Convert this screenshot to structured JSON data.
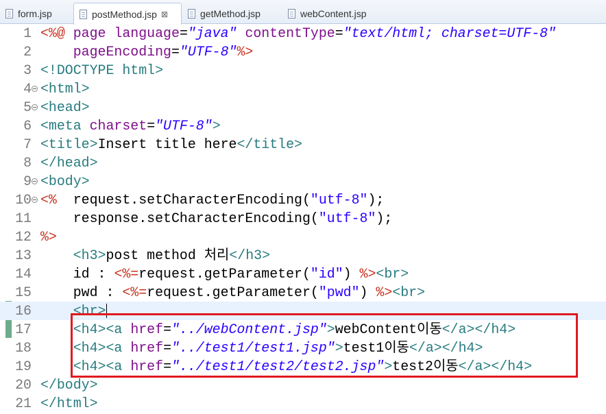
{
  "tabs": [
    {
      "label": "form.jsp",
      "active": false
    },
    {
      "label": "postMethod.jsp",
      "active": true,
      "close": "⊠"
    },
    {
      "label": "getMethod.jsp",
      "active": false
    },
    {
      "label": "webContent.jsp",
      "active": false
    }
  ],
  "editor": {
    "current_line": 16,
    "highlighted_lines": [
      17,
      18,
      19
    ],
    "lines": [
      {
        "n": "1",
        "parts": [
          [
            "jsp",
            "<%@ "
          ],
          [
            "attr",
            "page "
          ],
          [
            "attr",
            "language"
          ],
          [
            "txt",
            "="
          ],
          [
            "str",
            "\"java\""
          ],
          [
            "txt",
            " "
          ],
          [
            "attr",
            "contentType"
          ],
          [
            "txt",
            "="
          ],
          [
            "str",
            "\"text/html; charset=UTF-8\""
          ]
        ]
      },
      {
        "n": "2",
        "parts": [
          [
            "txt",
            "    "
          ],
          [
            "attr",
            "pageEncoding"
          ],
          [
            "txt",
            "="
          ],
          [
            "str",
            "\"UTF-8\""
          ],
          [
            "jsp",
            "%>"
          ]
        ]
      },
      {
        "n": "3",
        "parts": [
          [
            "tag",
            "<!DOCTYPE html>"
          ]
        ]
      },
      {
        "n": "4",
        "fold": true,
        "parts": [
          [
            "tag",
            "<html>"
          ]
        ]
      },
      {
        "n": "5",
        "fold": true,
        "parts": [
          [
            "tag",
            "<head>"
          ]
        ]
      },
      {
        "n": "6",
        "parts": [
          [
            "tag",
            "<meta "
          ],
          [
            "attr",
            "charset"
          ],
          [
            "txt",
            "="
          ],
          [
            "str",
            "\"UTF-8\""
          ],
          [
            "tag",
            ">"
          ]
        ]
      },
      {
        "n": "7",
        "parts": [
          [
            "tag",
            "<title>"
          ],
          [
            "txt",
            "Insert title here"
          ],
          [
            "tag",
            "</title>"
          ]
        ]
      },
      {
        "n": "8",
        "parts": [
          [
            "tag",
            "</head>"
          ]
        ]
      },
      {
        "n": "9",
        "fold": true,
        "parts": [
          [
            "tag",
            "<body>"
          ]
        ]
      },
      {
        "n": "10",
        "fold": true,
        "parts": [
          [
            "jsp",
            "<%"
          ],
          [
            "txt",
            "  request.setCharacterEncoding("
          ],
          [
            "jstr",
            "\"utf-8\""
          ],
          [
            "txt",
            ");"
          ]
        ]
      },
      {
        "n": "11",
        "parts": [
          [
            "txt",
            "    response.setCharacterEncoding("
          ],
          [
            "jstr",
            "\"utf-8\""
          ],
          [
            "txt",
            ");"
          ]
        ]
      },
      {
        "n": "12",
        "parts": [
          [
            "jsp",
            "%>"
          ]
        ]
      },
      {
        "n": "13",
        "parts": [
          [
            "txt",
            "    "
          ],
          [
            "tag",
            "<h3>"
          ],
          [
            "txt",
            "post method 처리"
          ],
          [
            "tag",
            "</h3>"
          ]
        ]
      },
      {
        "n": "14",
        "parts": [
          [
            "txt",
            "    id : "
          ],
          [
            "jsp",
            "<%="
          ],
          [
            "txt",
            "request.getParameter("
          ],
          [
            "jstr",
            "\"id\""
          ],
          [
            "txt",
            ") "
          ],
          [
            "jsp",
            "%>"
          ],
          [
            "tag",
            "<br>"
          ]
        ]
      },
      {
        "n": "15",
        "parts": [
          [
            "txt",
            "    pwd : "
          ],
          [
            "jsp",
            "<%="
          ],
          [
            "txt",
            "request.getParameter("
          ],
          [
            "jstr",
            "\"pwd\""
          ],
          [
            "txt",
            ") "
          ],
          [
            "jsp",
            "%>"
          ],
          [
            "tag",
            "<br>"
          ]
        ]
      },
      {
        "n": "16",
        "parts": [
          [
            "txt",
            "    "
          ],
          [
            "tag",
            "<hr>"
          ]
        ],
        "caret": true
      },
      {
        "n": "17",
        "parts": [
          [
            "txt",
            "    "
          ],
          [
            "tag",
            "<h4><a "
          ],
          [
            "attr",
            "href"
          ],
          [
            "txt",
            "="
          ],
          [
            "str",
            "\"../webContent.jsp\""
          ],
          [
            "tag",
            ">"
          ],
          [
            "txt",
            "webContent이동"
          ],
          [
            "tag",
            "</a></h4>"
          ]
        ]
      },
      {
        "n": "18",
        "parts": [
          [
            "txt",
            "    "
          ],
          [
            "tag",
            "<h4><a "
          ],
          [
            "attr",
            "href"
          ],
          [
            "txt",
            "="
          ],
          [
            "str",
            "\"../test1/test1.jsp\""
          ],
          [
            "tag",
            ">"
          ],
          [
            "txt",
            "test1이동"
          ],
          [
            "tag",
            "</a></h4>"
          ]
        ]
      },
      {
        "n": "19",
        "parts": [
          [
            "txt",
            "    "
          ],
          [
            "tag",
            "<h4><a "
          ],
          [
            "attr",
            "href"
          ],
          [
            "txt",
            "="
          ],
          [
            "str",
            "\"../test1/test2/test2.jsp\""
          ],
          [
            "tag",
            ">"
          ],
          [
            "txt",
            "test2이동"
          ],
          [
            "tag",
            "</a></h4>"
          ]
        ]
      },
      {
        "n": "20",
        "parts": [
          [
            "tag",
            "</body>"
          ]
        ]
      },
      {
        "n": "21",
        "parts": [
          [
            "tag",
            "</html>"
          ]
        ]
      }
    ]
  },
  "colors": {
    "tag": "#277b7e",
    "attr": "#7f0f8c",
    "string": "#2a00ff",
    "jsp": "#c9301e",
    "highlight_border": "#e0191f",
    "current_line_bg": "#e8f2fe"
  }
}
